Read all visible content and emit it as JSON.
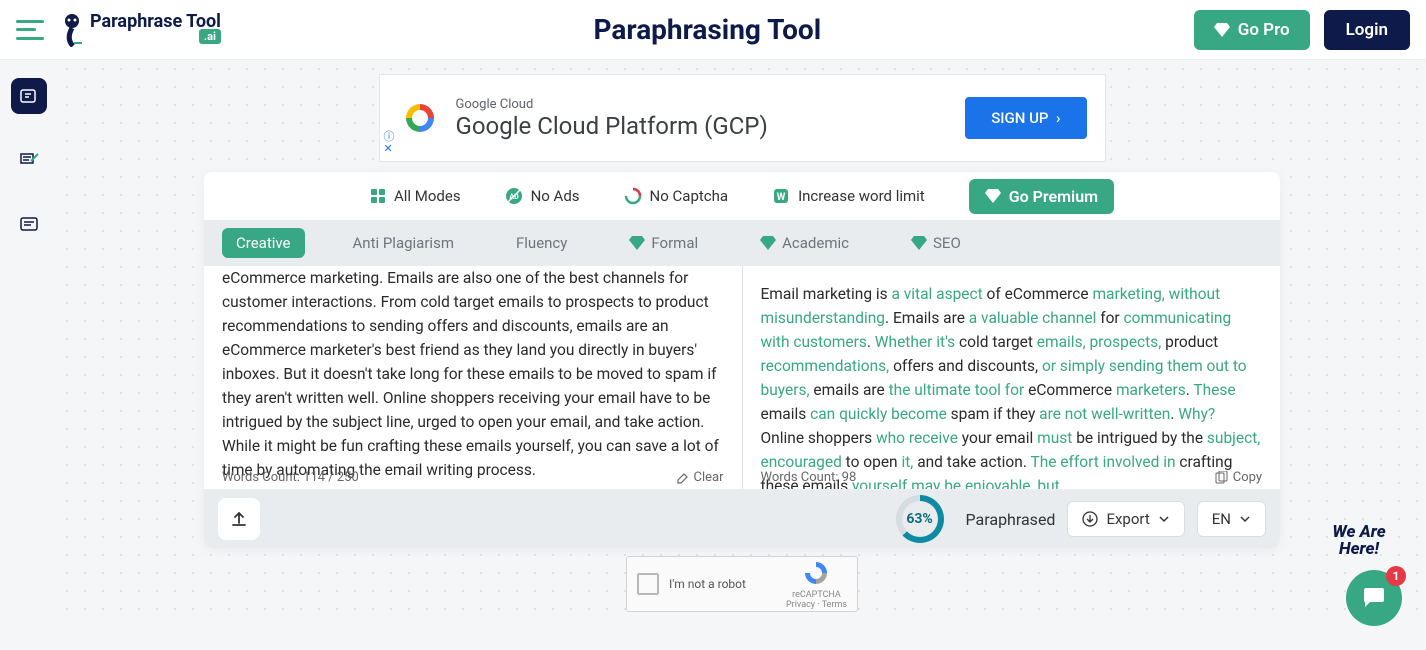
{
  "header": {
    "logo_text": "Paraphrase Tool",
    "logo_badge": ".ai",
    "title": "Paraphrasing Tool",
    "go_pro": "Go Pro",
    "login": "Login"
  },
  "sidebar": {
    "items": [
      "paraphrase-tool",
      "grammar-check",
      "summarize"
    ]
  },
  "ad": {
    "subtitle": "Google Cloud",
    "title": "Google Cloud Platform (GCP)",
    "button": "SIGN UP"
  },
  "premium": {
    "all_modes": "All Modes",
    "no_ads": "No Ads",
    "no_captcha": "No Captcha",
    "word_limit": "Increase word limit",
    "button": "Go Premium"
  },
  "tabs": [
    "Creative",
    "Anti Plagiarism",
    "Fluency",
    "Formal",
    "Academic",
    "SEO"
  ],
  "input": {
    "text": "eCommerce marketing. Emails are also one of the best channels for customer interactions. From cold target emails to prospects to product recommendations to sending offers and discounts, emails are an eCommerce marketer's best friend as they land you directly in buyers' inboxes. But it doesn't take long for these emails to be moved to spam if they aren't written well. Online shoppers receiving your email have to be intrigued by the subject line, urged to open your email, and take action. While it might be fun crafting these emails yourself, you can save a lot of time by automating the email writing process.",
    "word_count": "Words Count: 114 / 250",
    "clear": "Clear"
  },
  "output": {
    "segments": [
      {
        "t": "Email marketing is ",
        "h": 0
      },
      {
        "t": "a vital aspect",
        "h": 1
      },
      {
        "t": " of eCommerce ",
        "h": 0
      },
      {
        "t": "marketing, without misunderstanding",
        "h": 1
      },
      {
        "t": ". Emails are ",
        "h": 0
      },
      {
        "t": "a valuable channel",
        "h": 1
      },
      {
        "t": " for ",
        "h": 0
      },
      {
        "t": "communicating with customers",
        "h": 1
      },
      {
        "t": ". ",
        "h": 0
      },
      {
        "t": "Whether it's",
        "h": 1
      },
      {
        "t": " cold target ",
        "h": 0
      },
      {
        "t": "emails, prospects,",
        "h": 1
      },
      {
        "t": " product ",
        "h": 0
      },
      {
        "t": "recommendations,",
        "h": 1
      },
      {
        "t": " offers and discounts, ",
        "h": 0
      },
      {
        "t": "or simply sending them out to buyers,",
        "h": 1
      },
      {
        "t": " emails are ",
        "h": 0
      },
      {
        "t": "the ultimate tool for",
        "h": 1
      },
      {
        "t": " eCommerce ",
        "h": 0
      },
      {
        "t": "marketers",
        "h": 1
      },
      {
        "t": ". ",
        "h": 0
      },
      {
        "t": "These",
        "h": 1
      },
      {
        "t": " emails ",
        "h": 0
      },
      {
        "t": "can quickly become",
        "h": 1
      },
      {
        "t": " spam if they ",
        "h": 0
      },
      {
        "t": "are not well-written",
        "h": 1
      },
      {
        "t": ". ",
        "h": 0
      },
      {
        "t": "Why?",
        "h": 1
      },
      {
        "t": " Online shoppers ",
        "h": 0
      },
      {
        "t": "who receive",
        "h": 1
      },
      {
        "t": " your email ",
        "h": 0
      },
      {
        "t": "must",
        "h": 1
      },
      {
        "t": " be intrigued by the ",
        "h": 0
      },
      {
        "t": "subject, encouraged",
        "h": 1
      },
      {
        "t": " to open ",
        "h": 0
      },
      {
        "t": "it,",
        "h": 1
      },
      {
        "t": " and take action. ",
        "h": 0
      },
      {
        "t": "The effort involved in",
        "h": 1
      },
      {
        "t": " crafting these emails ",
        "h": 0
      },
      {
        "t": "yourself may be enjoyable, but",
        "h": 1
      }
    ],
    "word_count": "Words Count: 98",
    "copy": "Copy"
  },
  "bottom": {
    "percent": "63%",
    "paraphrased": "Paraphrased",
    "export": "Export",
    "lang": "EN"
  },
  "captcha": {
    "label": "I'm not a robot",
    "brand": "reCAPTCHA",
    "terms": "Privacy · Terms"
  },
  "help": {
    "text": "We Are Here!",
    "badge": "1"
  }
}
